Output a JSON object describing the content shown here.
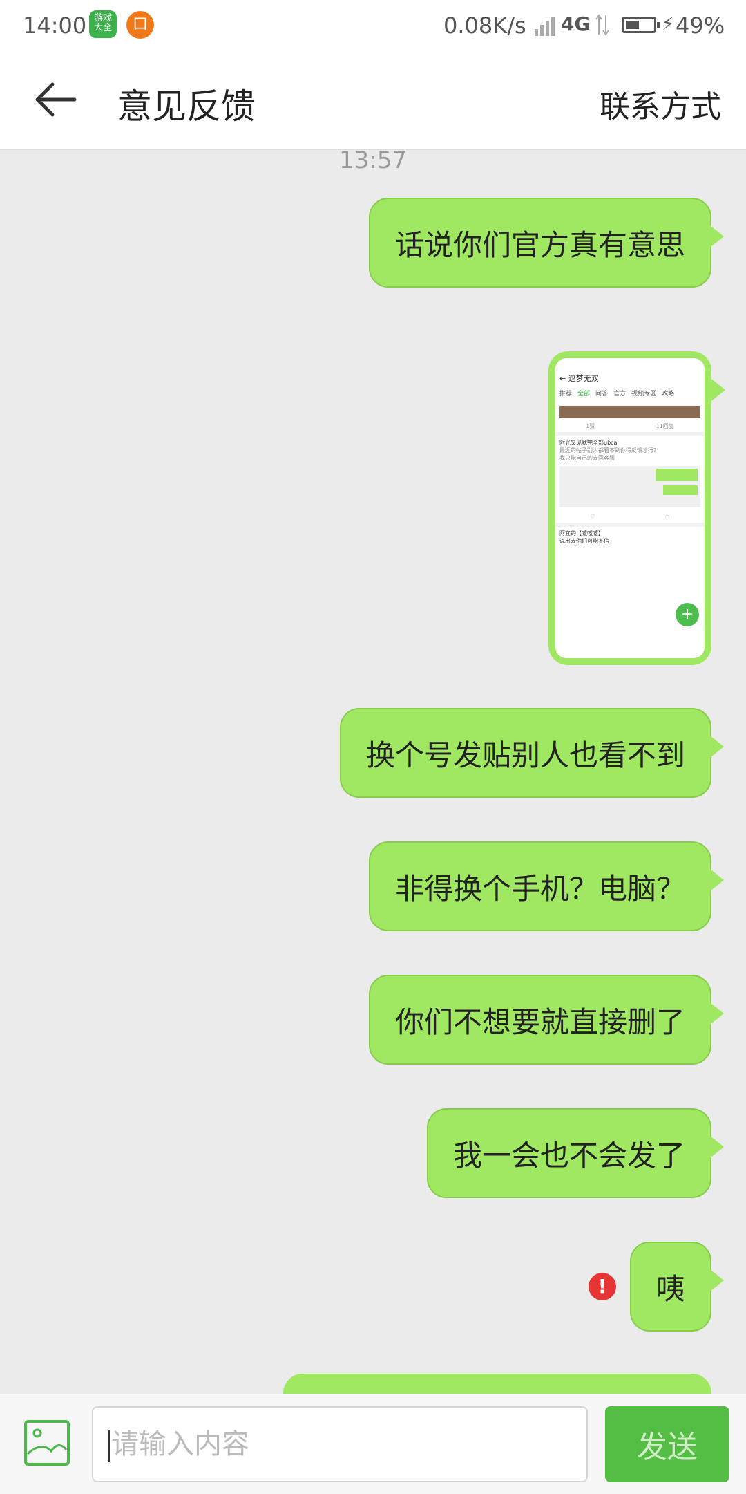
{
  "status_bar": {
    "time": "14:00",
    "app_icon_1_text": "游戏大全",
    "app_icon_2_text": "口",
    "network_speed": "0.08K/s",
    "network_type": "4G",
    "battery_percent": "49%",
    "battery_level": 0.49
  },
  "header": {
    "title": "意见反馈",
    "contact_label": "联系方式"
  },
  "chat": {
    "timestamp": "13:57",
    "messages": [
      {
        "text": "话说你们官方真有意思"
      },
      {
        "text": "换个号发贴别人也看不到"
      },
      {
        "text": "非得换个手机？电脑？"
      },
      {
        "text": "你们不想要就直接删了"
      },
      {
        "text": "我一会也不会发了"
      },
      {
        "text": "咦"
      }
    ],
    "screenshot": {
      "title": "遮梦无双",
      "tabs": [
        "推荐",
        "全部",
        "问答",
        "官方",
        "视频专区",
        "攻略"
      ],
      "active_tab": "全部",
      "post_author": "附光又见就完全部ubca",
      "post_line_1": "最近的帖子别人都看不到你得反馈才行？",
      "post_line_2": "我只能自己的去问客服",
      "second_author": "阿宜的【嘘嘘嘘】",
      "second_line": "说出去你们可能不信",
      "likes": "1赞",
      "replies": "11回复"
    },
    "error_glyph": "!"
  },
  "input_bar": {
    "placeholder": "请输入内容",
    "send_label": "发送"
  },
  "colors": {
    "bubble": "#a1e862",
    "send_button": "#54bd43",
    "error": "#e63535",
    "background": "#ebebeb"
  }
}
